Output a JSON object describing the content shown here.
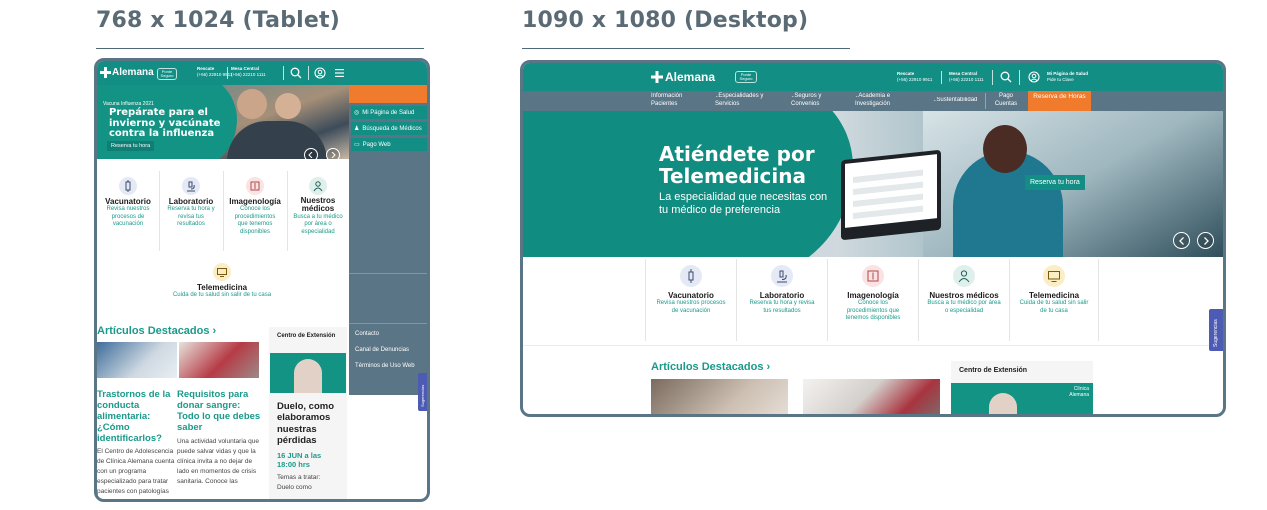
{
  "tablet": {
    "heading": "768 x 1024 (Tablet)",
    "logo": "Alemana",
    "ribbon": "Ponte Seguro",
    "rescate_label": "Rescate",
    "rescate_phone": "(+56) 22910 9911",
    "mesa_label": "Mesa Central",
    "mesa_phone": "(+56) 22210 1111",
    "hero": {
      "kicker": "Vacuna Influenza 2021",
      "title": "Prepárate para el invierno y vacúnate contra la influenza",
      "button": "Reserva tu hora"
    },
    "cards": [
      {
        "title": "Vacunatorio",
        "desc": "Revisa nuestros procesos de vacunación"
      },
      {
        "title": "Laboratorio",
        "desc": "Reserva tu hora y revisa tus resultados"
      },
      {
        "title": "Imagenología",
        "desc": "Conoce los procedimientos que tenemos disponibles"
      },
      {
        "title": "Nuestros médicos",
        "desc": "Busca a tu médico por área o especialidad"
      }
    ],
    "tele": {
      "title": "Telemedicina",
      "desc": "Cuida de tu salud sin salir de tu casa"
    },
    "articles_heading": "Artículos Destacados",
    "articles": [
      {
        "title": "Trastornos de la conducta alimentaria: ¿Cómo identificarlos?",
        "body": "El Centro de Adolescencia de Clínica Alemana cuenta con un programa especializado para tratar pacientes con patologías"
      },
      {
        "title": "Requisitos para donar sangre: Todo lo que debes saber",
        "body": "Una actividad voluntaria que puede salvar vidas y que la clínica invita a no dejar de lado en momentos de crisis sanitaria. Conoce las"
      }
    ],
    "extension": {
      "heading": "Centro de Extensión",
      "title": "Duelo, como elaboramos nuestras pérdidas",
      "date": "16 JUN a las 18:00 hrs",
      "body": "Temas a tratar: Duelo como"
    },
    "menu": {
      "items": [
        "Mi Página de Salud",
        "Búsqueda de Médicos",
        "Pago Web"
      ],
      "footer_links": [
        "Contacto",
        "Canal de Denuncias",
        "Términos de Uso Web"
      ]
    },
    "feedback_tab": "Sugerencias"
  },
  "desktop": {
    "heading": "1090 x 1080 (Desktop)",
    "logo": "Alemana",
    "ribbon": "Ponte Seguro",
    "rescate_label": "Rescate",
    "rescate_phone": "(+56) 22910 9911",
    "mesa_label": "Mesa Central",
    "mesa_phone": "(+56) 22210 1111",
    "account_title": "Mi Página de Salud",
    "account_sub": "Pide tu Clave",
    "nav": [
      "Información Pacientes",
      "Especialidades y Servicios",
      "Seguros y Convenios",
      "Academia e Investigación",
      "Sustentabilidad",
      "Pago Cuentas"
    ],
    "nav_cta": "Reserva de Horas",
    "hero": {
      "title": "Atiéndete por Telemedicina",
      "subtitle": "La especialidad que necesitas con tu médico de preferencia",
      "button": "Reserva tu hora"
    },
    "cards": [
      {
        "title": "Vacunatorio",
        "desc": "Revisa nuestros procesos de vacunación"
      },
      {
        "title": "Laboratorio",
        "desc": "Reserva tu hora y revisa tus resultados"
      },
      {
        "title": "Imagenología",
        "desc": "Conoce los procedimientos que tenemos disponibles"
      },
      {
        "title": "Nuestros médicos",
        "desc": "Busca a tu médico por área o especialidad"
      },
      {
        "title": "Telemedicina",
        "desc": "Cuida de tu salud sin salir de tu casa"
      }
    ],
    "articles_heading": "Artículos Destacados",
    "extension_heading": "Centro de Extensión",
    "extension_banner": "Clínica Alemana",
    "feedback_tab": "Sugerencias"
  },
  "colors": {
    "teal": "#138e84",
    "orange": "#f07b2c",
    "slate": "#5a7585",
    "text_teal": "#1a9a8b"
  }
}
